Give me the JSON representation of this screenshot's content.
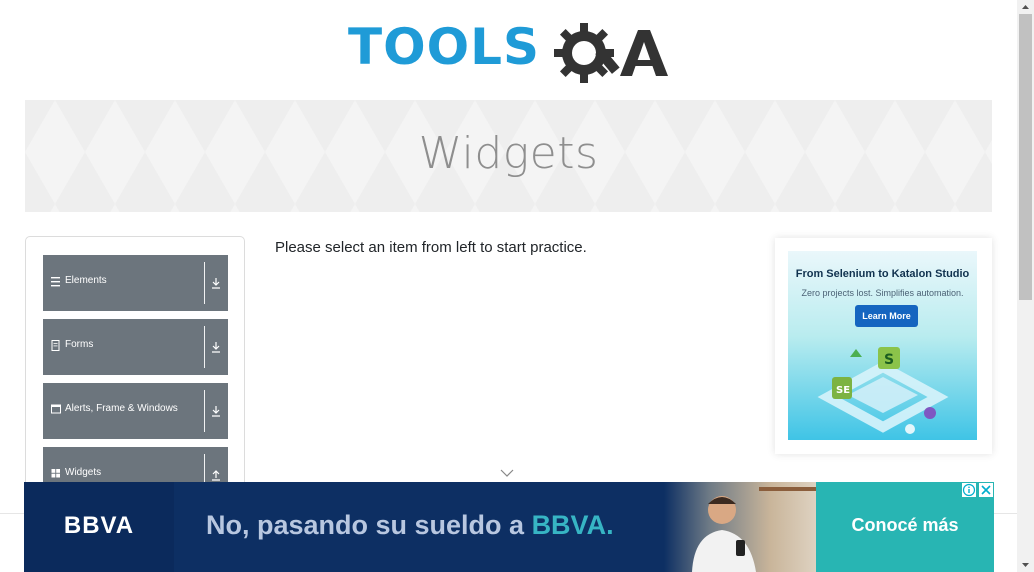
{
  "header": {
    "logo_text_left": "TOOLS",
    "logo_text_right": "QA"
  },
  "banner": {
    "title": "Widgets"
  },
  "sidebar": {
    "groups": [
      {
        "label": "Elements",
        "icon": "list-icon",
        "toggle": "download-icon"
      },
      {
        "label": "Forms",
        "icon": "form-icon",
        "toggle": "download-icon"
      },
      {
        "label": "Alerts, Frame & Windows",
        "icon": "window-icon",
        "toggle": "download-icon"
      },
      {
        "label": "Widgets",
        "icon": "grid-icon",
        "toggle": "upload-icon"
      }
    ]
  },
  "main": {
    "instruction": "Please select an item from left to start practice."
  },
  "side_ad": {
    "headline": "From Selenium to Katalon Studio",
    "subline": "Zero projects lost. Simplifies automation.",
    "button": "Learn More"
  },
  "bottom_ad": {
    "brand": "BBVA",
    "message_prefix": "No, pasando su sueldo a ",
    "message_accent": "BBVA.",
    "cta": "Conocé más",
    "colors": {
      "navy": "#0d2f63",
      "teal": "#28b5b3",
      "accent_text": "#37b5c4"
    }
  },
  "colors": {
    "logo_blue": "#1f9bd7",
    "logo_dark": "#333333",
    "group_bg": "#6c757d"
  }
}
